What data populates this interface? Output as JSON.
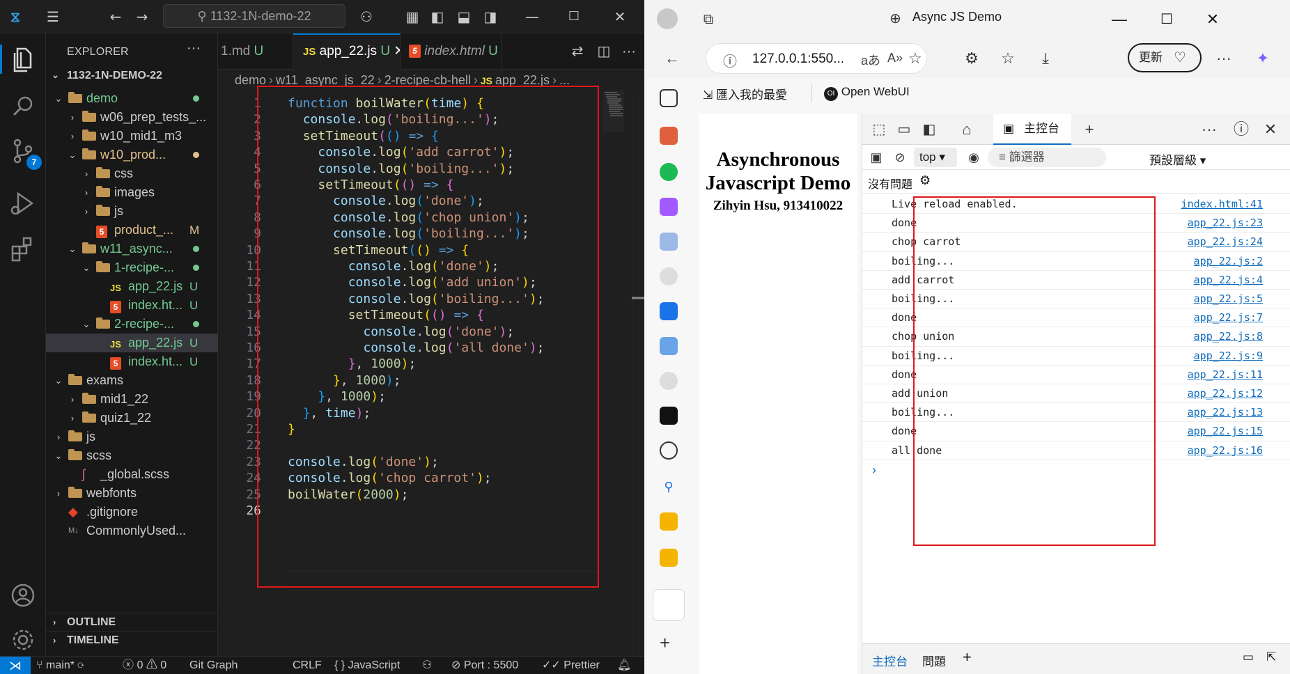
{
  "vscode": {
    "search_text": "1132-1N-demo-22",
    "explorer_title": "EXPLORER",
    "root_folder": "1132-1N-DEMO-22",
    "tree": [
      {
        "label": "demo",
        "depth": 1,
        "kind": "folder",
        "open": true,
        "status": "dot",
        "color": "#73c991"
      },
      {
        "label": "w06_prep_tests_...",
        "depth": 2,
        "kind": "folder",
        "open": false,
        "status": "",
        "color": "#cccccc"
      },
      {
        "label": "w10_mid1_m3",
        "depth": 2,
        "kind": "folder",
        "open": false,
        "status": "",
        "color": "#cccccc"
      },
      {
        "label": "w10_prod...",
        "depth": 2,
        "kind": "folder",
        "open": true,
        "status": "dot",
        "color": "#e2c08d"
      },
      {
        "label": "css",
        "depth": 3,
        "kind": "folder",
        "open": false,
        "status": "",
        "color": "#cccccc"
      },
      {
        "label": "images",
        "depth": 3,
        "kind": "folder",
        "open": false,
        "status": "",
        "color": "#cccccc"
      },
      {
        "label": "js",
        "depth": 3,
        "kind": "folder",
        "open": false,
        "status": "",
        "color": "#cccccc"
      },
      {
        "label": "product_...",
        "depth": 3,
        "kind": "html",
        "open": false,
        "status": "M",
        "color": "#e2c08d"
      },
      {
        "label": "w11_async...",
        "depth": 2,
        "kind": "folder",
        "open": true,
        "status": "dot",
        "color": "#73c991"
      },
      {
        "label": "1-recipe-...",
        "depth": 3,
        "kind": "folder",
        "open": true,
        "status": "dot",
        "color": "#73c991"
      },
      {
        "label": "app_22.js",
        "depth": 4,
        "kind": "js",
        "open": false,
        "status": "U",
        "color": "#73c991"
      },
      {
        "label": "index.ht...",
        "depth": 4,
        "kind": "html",
        "open": false,
        "status": "U",
        "color": "#73c991"
      },
      {
        "label": "2-recipe-...",
        "depth": 3,
        "kind": "folder",
        "open": true,
        "status": "dot",
        "color": "#73c991"
      },
      {
        "label": "app_22.js",
        "depth": 4,
        "kind": "js",
        "open": false,
        "status": "U",
        "color": "#73c991",
        "selected": true
      },
      {
        "label": "index.ht...",
        "depth": 4,
        "kind": "html",
        "open": false,
        "status": "U",
        "color": "#73c991"
      },
      {
        "label": "exams",
        "depth": 1,
        "kind": "folder",
        "open": true,
        "status": "",
        "color": "#cccccc"
      },
      {
        "label": "mid1_22",
        "depth": 2,
        "kind": "folder",
        "open": false,
        "status": "",
        "color": "#cccccc"
      },
      {
        "label": "quiz1_22",
        "depth": 2,
        "kind": "folder",
        "open": false,
        "status": "",
        "color": "#cccccc"
      },
      {
        "label": "js",
        "depth": 1,
        "kind": "folder",
        "open": false,
        "status": "",
        "color": "#cccccc"
      },
      {
        "label": "scss",
        "depth": 1,
        "kind": "folder",
        "open": true,
        "status": "",
        "color": "#cccccc"
      },
      {
        "label": "_global.scss",
        "depth": 2,
        "kind": "scss",
        "open": false,
        "status": "",
        "color": "#cccccc"
      },
      {
        "label": "webfonts",
        "depth": 1,
        "kind": "folder",
        "open": false,
        "status": "",
        "color": "#cccccc"
      },
      {
        "label": ".gitignore",
        "depth": 1,
        "kind": "git",
        "open": false,
        "status": "",
        "color": "#cccccc"
      },
      {
        "label": "CommonlyUsed...",
        "depth": 1,
        "kind": "md",
        "open": false,
        "status": "",
        "color": "#cccccc"
      }
    ],
    "outline_label": "OUTLINE",
    "timeline_label": "TIMELINE",
    "tabs": [
      {
        "icon": "",
        "name": "1.md",
        "status": "U",
        "active": false
      },
      {
        "icon": "JS",
        "name": "app_22.js",
        "status": "U",
        "active": true
      },
      {
        "icon": "5",
        "name": "index.html",
        "status": "U",
        "active": false
      }
    ],
    "breadcrumb": [
      "demo",
      "w11_async_js_22",
      "2-recipe-cb-hell",
      "app_22.js",
      "..."
    ],
    "code_lines": [
      [
        [
          "kw",
          "function "
        ],
        [
          "fn",
          "boilWater"
        ],
        [
          "p1",
          "("
        ],
        [
          "vr",
          "time"
        ],
        [
          "p1",
          ")"
        ],
        [
          "pl",
          " "
        ],
        [
          "p1",
          "{"
        ]
      ],
      [
        [
          "pl",
          "  "
        ],
        [
          "vr",
          "console"
        ],
        [
          "pl",
          "."
        ],
        [
          "fn",
          "log"
        ],
        [
          "p2",
          "("
        ],
        [
          "st",
          "'boiling...'"
        ],
        [
          "p2",
          ")"
        ],
        [
          "pl",
          ";"
        ]
      ],
      [
        [
          "pl",
          "  "
        ],
        [
          "fn",
          "setTimeout"
        ],
        [
          "p2",
          "("
        ],
        [
          "p3",
          "()"
        ],
        [
          "pl",
          " "
        ],
        [
          "kw",
          "=>"
        ],
        [
          "pl",
          " "
        ],
        [
          "p3",
          "{"
        ]
      ],
      [
        [
          "pl",
          "    "
        ],
        [
          "vr",
          "console"
        ],
        [
          "pl",
          "."
        ],
        [
          "fn",
          "log"
        ],
        [
          "p1",
          "("
        ],
        [
          "st",
          "'add carrot'"
        ],
        [
          "p1",
          ")"
        ],
        [
          "pl",
          ";"
        ]
      ],
      [
        [
          "pl",
          "    "
        ],
        [
          "vr",
          "console"
        ],
        [
          "pl",
          "."
        ],
        [
          "fn",
          "log"
        ],
        [
          "p1",
          "("
        ],
        [
          "st",
          "'boiling...'"
        ],
        [
          "p1",
          ")"
        ],
        [
          "pl",
          ";"
        ]
      ],
      [
        [
          "pl",
          "    "
        ],
        [
          "fn",
          "setTimeout"
        ],
        [
          "p1",
          "("
        ],
        [
          "p2",
          "()"
        ],
        [
          "pl",
          " "
        ],
        [
          "kw",
          "=>"
        ],
        [
          "pl",
          " "
        ],
        [
          "p2",
          "{"
        ]
      ],
      [
        [
          "pl",
          "      "
        ],
        [
          "vr",
          "console"
        ],
        [
          "pl",
          "."
        ],
        [
          "fn",
          "log"
        ],
        [
          "p3",
          "("
        ],
        [
          "st",
          "'done'"
        ],
        [
          "p3",
          ")"
        ],
        [
          "pl",
          ";"
        ]
      ],
      [
        [
          "pl",
          "      "
        ],
        [
          "vr",
          "console"
        ],
        [
          "pl",
          "."
        ],
        [
          "fn",
          "log"
        ],
        [
          "p3",
          "("
        ],
        [
          "st",
          "'chop union'"
        ],
        [
          "p3",
          ")"
        ],
        [
          "pl",
          ";"
        ]
      ],
      [
        [
          "pl",
          "      "
        ],
        [
          "vr",
          "console"
        ],
        [
          "pl",
          "."
        ],
        [
          "fn",
          "log"
        ],
        [
          "p3",
          "("
        ],
        [
          "st",
          "'boiling...'"
        ],
        [
          "p3",
          ")"
        ],
        [
          "pl",
          ";"
        ]
      ],
      [
        [
          "pl",
          "      "
        ],
        [
          "fn",
          "setTimeout"
        ],
        [
          "p3",
          "("
        ],
        [
          "p1",
          "()"
        ],
        [
          "pl",
          " "
        ],
        [
          "kw",
          "=>"
        ],
        [
          "pl",
          " "
        ],
        [
          "p1",
          "{"
        ]
      ],
      [
        [
          "pl",
          "        "
        ],
        [
          "vr",
          "console"
        ],
        [
          "pl",
          "."
        ],
        [
          "fn",
          "log"
        ],
        [
          "p1",
          "("
        ],
        [
          "st",
          "'done'"
        ],
        [
          "p1",
          ")"
        ],
        [
          "pl",
          ";"
        ]
      ],
      [
        [
          "pl",
          "        "
        ],
        [
          "vr",
          "console"
        ],
        [
          "pl",
          "."
        ],
        [
          "fn",
          "log"
        ],
        [
          "p1",
          "("
        ],
        [
          "st",
          "'add union'"
        ],
        [
          "p1",
          ")"
        ],
        [
          "pl",
          ";"
        ]
      ],
      [
        [
          "pl",
          "        "
        ],
        [
          "vr",
          "console"
        ],
        [
          "pl",
          "."
        ],
        [
          "fn",
          "log"
        ],
        [
          "p1",
          "("
        ],
        [
          "st",
          "'boiling...'"
        ],
        [
          "p1",
          ")"
        ],
        [
          "pl",
          ";"
        ]
      ],
      [
        [
          "pl",
          "        "
        ],
        [
          "fn",
          "setTimeout"
        ],
        [
          "p1",
          "("
        ],
        [
          "p2",
          "()"
        ],
        [
          "pl",
          " "
        ],
        [
          "kw",
          "=>"
        ],
        [
          "pl",
          " "
        ],
        [
          "p2",
          "{"
        ]
      ],
      [
        [
          "pl",
          "          "
        ],
        [
          "vr",
          "console"
        ],
        [
          "pl",
          "."
        ],
        [
          "fn",
          "log"
        ],
        [
          "p2",
          "("
        ],
        [
          "st",
          "'done'"
        ],
        [
          "p2",
          ")"
        ],
        [
          "pl",
          ";"
        ]
      ],
      [
        [
          "pl",
          "          "
        ],
        [
          "vr",
          "console"
        ],
        [
          "pl",
          "."
        ],
        [
          "fn",
          "log"
        ],
        [
          "p2",
          "("
        ],
        [
          "st",
          "'all done'"
        ],
        [
          "p2",
          ")"
        ],
        [
          "pl",
          ";"
        ]
      ],
      [
        [
          "pl",
          "        "
        ],
        [
          "p2",
          "}"
        ],
        [
          "pl",
          ", "
        ],
        [
          "nm",
          "1000"
        ],
        [
          "p1",
          ")"
        ],
        [
          "pl",
          ";"
        ]
      ],
      [
        [
          "pl",
          "      "
        ],
        [
          "p1",
          "}"
        ],
        [
          "pl",
          ", "
        ],
        [
          "nm",
          "1000"
        ],
        [
          "p3",
          ")"
        ],
        [
          "pl",
          ";"
        ]
      ],
      [
        [
          "pl",
          "    "
        ],
        [
          "p3",
          "}"
        ],
        [
          "pl",
          ", "
        ],
        [
          "nm",
          "1000"
        ],
        [
          "p1",
          ")"
        ],
        [
          "pl",
          ";"
        ]
      ],
      [
        [
          "pl",
          "  "
        ],
        [
          "p3",
          "}"
        ],
        [
          "pl",
          ", "
        ],
        [
          "vr",
          "time"
        ],
        [
          "p2",
          ")"
        ],
        [
          "pl",
          ";"
        ]
      ],
      [
        [
          "p1",
          "}"
        ]
      ],
      [],
      [
        [
          "vr",
          "console"
        ],
        [
          "pl",
          "."
        ],
        [
          "fn",
          "log"
        ],
        [
          "p1",
          "("
        ],
        [
          "st",
          "'done'"
        ],
        [
          "p1",
          ")"
        ],
        [
          "pl",
          ";"
        ]
      ],
      [
        [
          "vr",
          "console"
        ],
        [
          "pl",
          "."
        ],
        [
          "fn",
          "log"
        ],
        [
          "p1",
          "("
        ],
        [
          "st",
          "'chop carrot'"
        ],
        [
          "p1",
          ")"
        ],
        [
          "pl",
          ";"
        ]
      ],
      [
        [
          "fn",
          "boilWater"
        ],
        [
          "p1",
          "("
        ],
        [
          "nm",
          "2000"
        ],
        [
          "p1",
          ")"
        ],
        [
          "pl",
          ";"
        ]
      ],
      []
    ],
    "status": {
      "branch": "main*",
      "errors": "0",
      "warnings": "0",
      "git_graph": "Git Graph",
      "eol": "CRLF",
      "language": "JavaScript",
      "port": "Port : 5500",
      "prettier": "Prettier"
    }
  },
  "edge": {
    "window_title": "Async JS Demo",
    "address": "127.0.0.1:550...",
    "update_label": "更新",
    "fav_import": "匯入我的最愛",
    "fav_openwebui": "Open WebUI",
    "page_title": "Asynchronous Javascript Demo",
    "page_subtitle": "Zihyin Hsu, 913410022",
    "devtools": {
      "console_tab": "主控台",
      "context": "top",
      "filter_placeholder": "篩選器",
      "levels": "預設層級",
      "no_issues": "沒有問題",
      "drawer_console": "主控台",
      "drawer_issues": "問題"
    },
    "console": [
      {
        "msg": "Live reload enabled.",
        "src": "index.html:41"
      },
      {
        "msg": "done",
        "src": "app_22.js:23"
      },
      {
        "msg": "chop carrot",
        "src": "app_22.js:24"
      },
      {
        "msg": "boiling...",
        "src": "app_22.js:2"
      },
      {
        "msg": "add carrot",
        "src": "app_22.js:4"
      },
      {
        "msg": "boiling...",
        "src": "app_22.js:5"
      },
      {
        "msg": "done",
        "src": "app_22.js:7"
      },
      {
        "msg": "chop union",
        "src": "app_22.js:8"
      },
      {
        "msg": "boiling...",
        "src": "app_22.js:9"
      },
      {
        "msg": "done",
        "src": "app_22.js:11"
      },
      {
        "msg": "add union",
        "src": "app_22.js:12"
      },
      {
        "msg": "boiling...",
        "src": "app_22.js:13"
      },
      {
        "msg": "done",
        "src": "app_22.js:15"
      },
      {
        "msg": "all done",
        "src": "app_22.js:16"
      }
    ]
  }
}
